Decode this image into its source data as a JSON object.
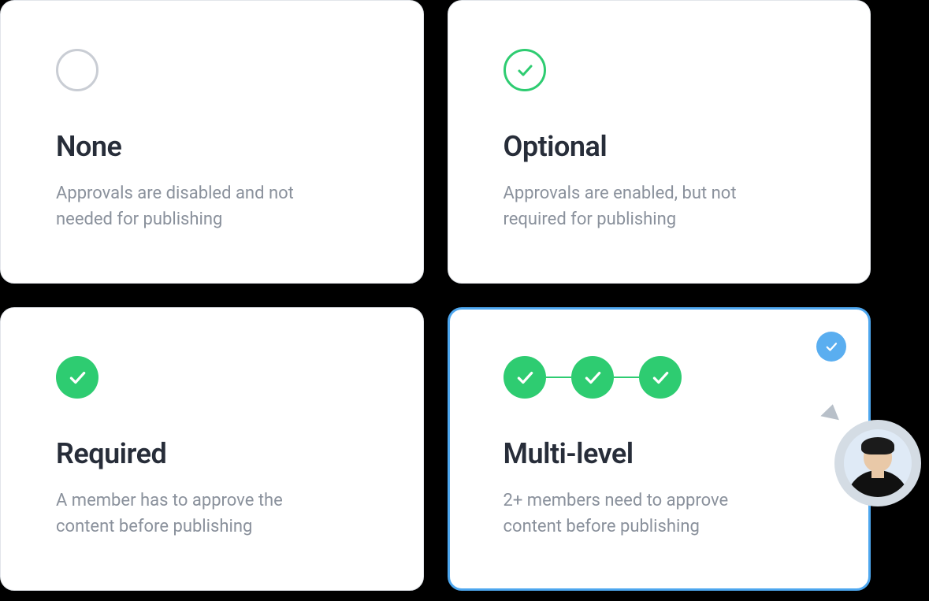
{
  "options": [
    {
      "id": "none",
      "title": "None",
      "description": "Approvals are disabled and not needed for publishing",
      "icon": "circle-empty",
      "selected": false
    },
    {
      "id": "optional",
      "title": "Optional",
      "description": "Approvals are enabled, but not required for publishing",
      "icon": "circle-outline-check",
      "selected": false
    },
    {
      "id": "required",
      "title": "Required",
      "description": "A member has to approve the content before publishing",
      "icon": "circle-filled-check",
      "selected": false
    },
    {
      "id": "multi-level",
      "title": "Multi-level",
      "description": "2+ members need to approve content before publishing",
      "icon": "multi-check",
      "selected": true
    }
  ],
  "colors": {
    "accent_green": "#2ecc71",
    "accent_blue": "#4ea7ef",
    "text_heading": "#272d39",
    "text_body": "#8a919c"
  },
  "avatar": {
    "semantic": "user-avatar"
  }
}
